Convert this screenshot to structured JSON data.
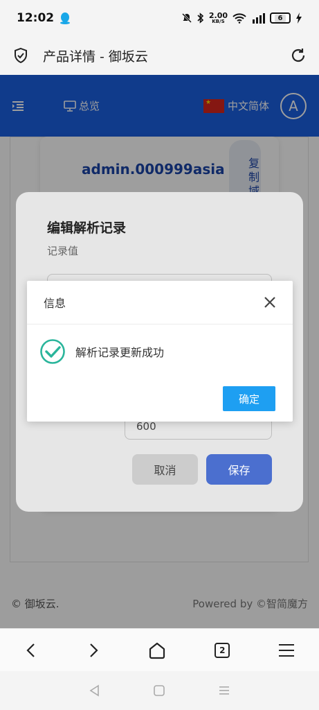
{
  "status": {
    "time": "12:02",
    "net_speed": "2.00",
    "net_unit": "KB/S",
    "battery": "6"
  },
  "browser": {
    "title": "产品详情 - 御坂云"
  },
  "site": {
    "nav_overview": "总览",
    "language": "中文简体",
    "avatar_letter": "A",
    "domain": "admin.000999asia",
    "copy_domain": "复制域",
    "footer_left": "© 御坂云.",
    "footer_right": "Powered by ©智简魔方"
  },
  "edit_dialog": {
    "title": "编辑解析记录",
    "record_value_label": "记录值",
    "ttl_value": "600",
    "cancel_label": "取消",
    "save_label": "保存"
  },
  "info_dialog": {
    "title": "信息",
    "message": "解析记录更新成功",
    "ok_label": "确定"
  },
  "toolbar": {
    "tab_count": "2"
  },
  "colors": {
    "header_blue": "#1b5fe0",
    "ok_blue": "#1e9ff2",
    "save_blue": "#4b6fcf",
    "success_green": "#2ab59b"
  }
}
